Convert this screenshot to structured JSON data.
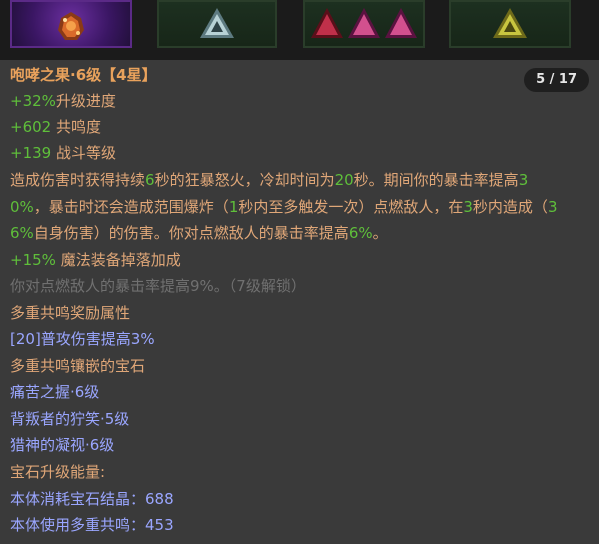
{
  "strip": {
    "gem_slots": [
      {
        "name": "orange-crystal-gem",
        "color": "#d96a2a"
      },
      {
        "name": "white-triangle-gem",
        "color": "#b8d2d6"
      },
      {
        "name": "red-pink-triangle-gems",
        "color": "#c0304a"
      },
      {
        "name": "yellow-triangle-gem",
        "color": "#c9c640"
      }
    ]
  },
  "tooltip": {
    "pager": "5 / 17",
    "title": "咆哮之果·6级【4星】",
    "stats": [
      {
        "value": "+32%",
        "label": "升级进度"
      },
      {
        "value": "+602",
        "label": " 共鸣度"
      },
      {
        "value": "+139",
        "label": " 战斗等级"
      }
    ],
    "desc_line1": {
      "a": "造成伤害时获得持续",
      "b": "6",
      "c": "秒的狂暴怒火，冷却时间为",
      "d": "20",
      "e": "秒。期间你的暴击率提高",
      "f": "3"
    },
    "desc_line2": {
      "a": "0%",
      "b": "，暴击时还会造成范围爆炸（",
      "c": "1",
      "d": "秒内至多触发一次）点燃敌人，在",
      "e": "3",
      "f": "秒内造成（",
      "g": "3"
    },
    "desc_line3": {
      "a": "6%",
      "b": "自身伤害）的伤害。你对点燃敌人的暴击率提高",
      "c": "6%",
      "d": "。"
    },
    "magic_drop": {
      "value": "+15%",
      "label": " 魔法装备掉落加成"
    },
    "locked_line": "你对点燃敌人的暴击率提高9%。（7级解锁）",
    "multi_resonance_title": "多重共鸣奖励属性",
    "bonus_line": "[20]普攻伤害提高3%",
    "embedded_title": "多重共鸣镶嵌的宝石",
    "embedded_gems": [
      "痛苦之握·6级",
      "背叛者的狞笑·5级",
      "猎神的凝视·6级"
    ],
    "upgrade_energy_title": "宝石升级能量:",
    "energy_lines": [
      {
        "label": "本体消耗宝石结晶：",
        "value": "688"
      },
      {
        "label": "本体使用多重共鸣：",
        "value": "453"
      }
    ]
  },
  "colors": {
    "panel_bg": "#3a3a3a",
    "title": "#e9a25c",
    "green": "#5fbf3a",
    "orange": "#e0a778",
    "blue": "#9aa6ff",
    "gray": "#707070"
  }
}
